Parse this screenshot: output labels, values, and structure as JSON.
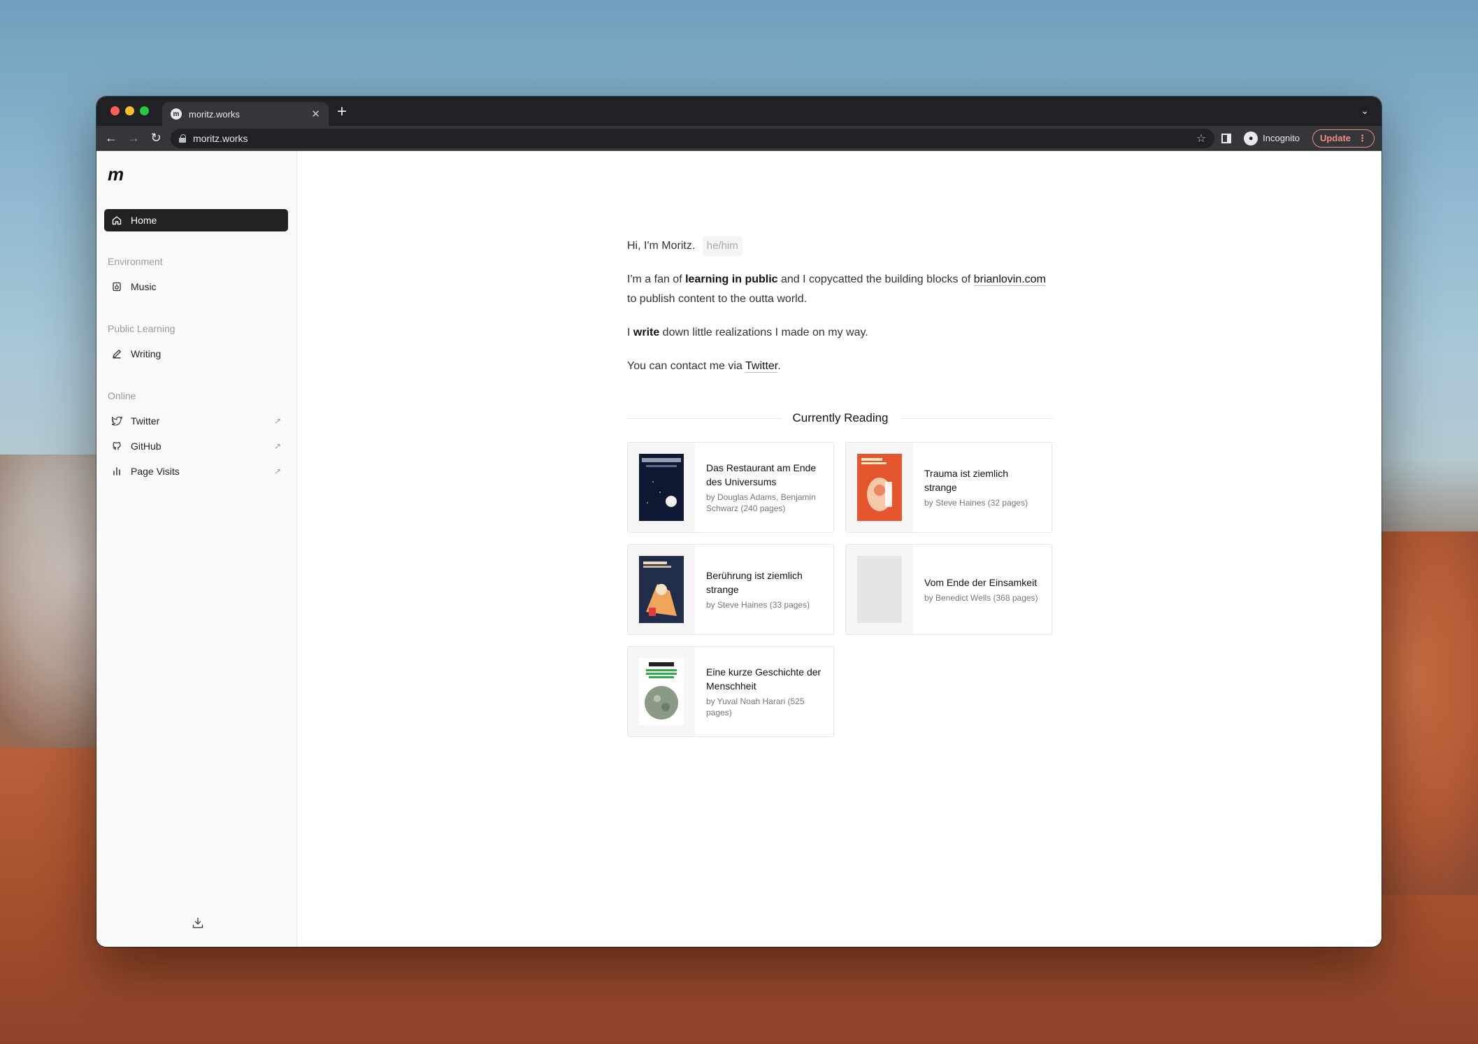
{
  "browser": {
    "tab_title": "moritz.works",
    "url": "moritz.works",
    "incognito_label": "Incognito",
    "update_label": "Update"
  },
  "sidebar": {
    "logo": "m",
    "home_label": "Home",
    "sections": [
      {
        "label": "Environment",
        "items": [
          {
            "label": "Music",
            "icon": "music-icon"
          }
        ]
      },
      {
        "label": "Public Learning",
        "items": [
          {
            "label": "Writing",
            "icon": "pencil-icon"
          }
        ]
      },
      {
        "label": "Online",
        "items": [
          {
            "label": "Twitter",
            "icon": "twitter-icon",
            "external": true
          },
          {
            "label": "GitHub",
            "icon": "github-icon",
            "external": true
          },
          {
            "label": "Page Visits",
            "icon": "bar-chart-icon",
            "external": true
          }
        ]
      }
    ]
  },
  "intro": {
    "greeting": "Hi, I'm Moritz.",
    "pronouns": "he/him",
    "p1_a": "I'm a fan of ",
    "p1_link": "learning in public",
    "p1_b": " and I copycatted the building blocks of ",
    "p1_link2": "brianlovin.com",
    "p1_c": " to publish content to the outta world.",
    "p2_a": "I ",
    "p2_link": "write",
    "p2_b": " down little realizations I made on my way.",
    "p3_a": "You can contact me via ",
    "p3_link": "Twitter",
    "p3_b": "."
  },
  "reading": {
    "title": "Currently Reading",
    "books": [
      {
        "title": "Das Restaurant am Ende des Universums",
        "meta": "by Douglas Adams, Benjamin Schwarz (240 pages)",
        "cover_color": "#0f1833"
      },
      {
        "title": "Trauma ist ziemlich strange",
        "meta": "by Steve Haines (32 pages)",
        "cover_color": "#e4572e"
      },
      {
        "title": "Berührung ist ziemlich strange",
        "meta": "by Steve Haines (33 pages)",
        "cover_color": "#1f2d4a"
      },
      {
        "title": "Vom Ende der Einsamkeit",
        "meta": "by Benedict Wells (368 pages)",
        "cover_color": "#e6e6e6"
      },
      {
        "title": "Eine kurze Geschichte der Menschheit",
        "meta": "by Yuval Noah Harari (525 pages)",
        "cover_color": "#ffffff"
      }
    ]
  }
}
